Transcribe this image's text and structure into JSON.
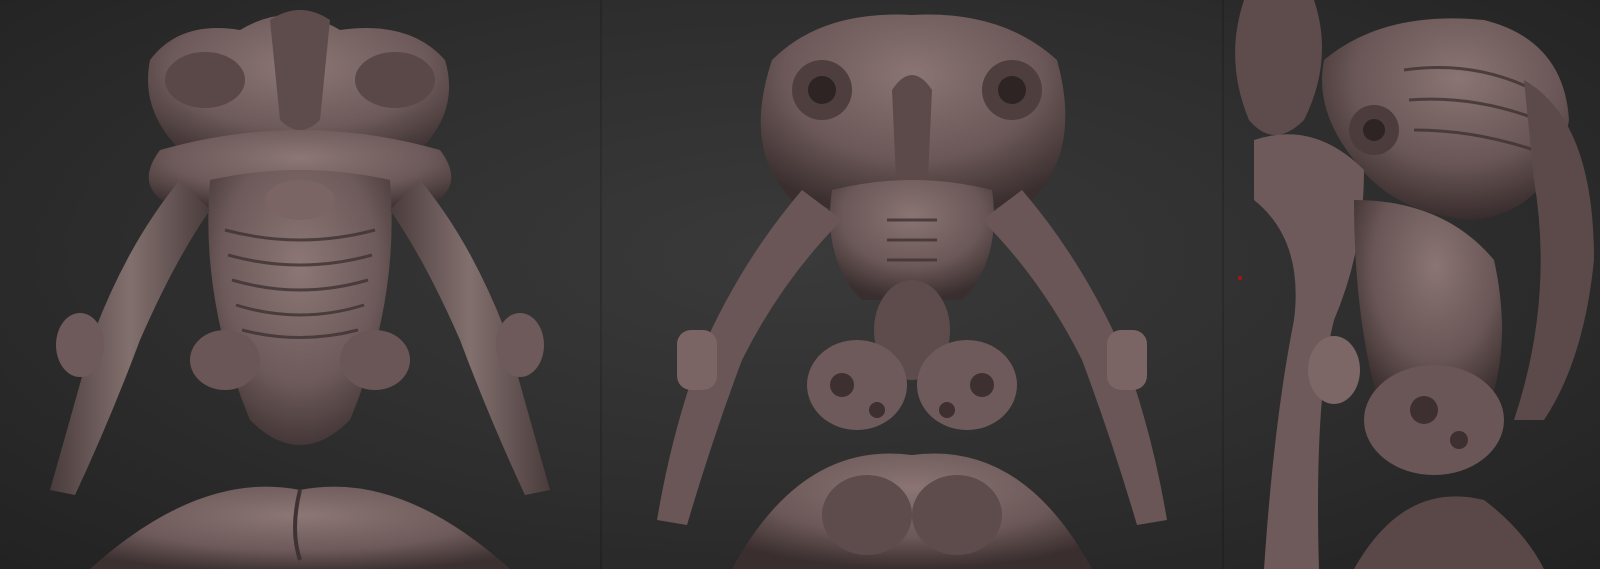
{
  "image": {
    "views": [
      {
        "view": "front"
      },
      {
        "view": "back"
      },
      {
        "view": "side"
      }
    ],
    "colors": {
      "background": "#2e2e2e",
      "clay": "#6e5a5a",
      "clay_light": "#8c7676",
      "clay_shadow": "#3c3030",
      "marker": "#b01010"
    },
    "marker": "red-dot-marker"
  }
}
